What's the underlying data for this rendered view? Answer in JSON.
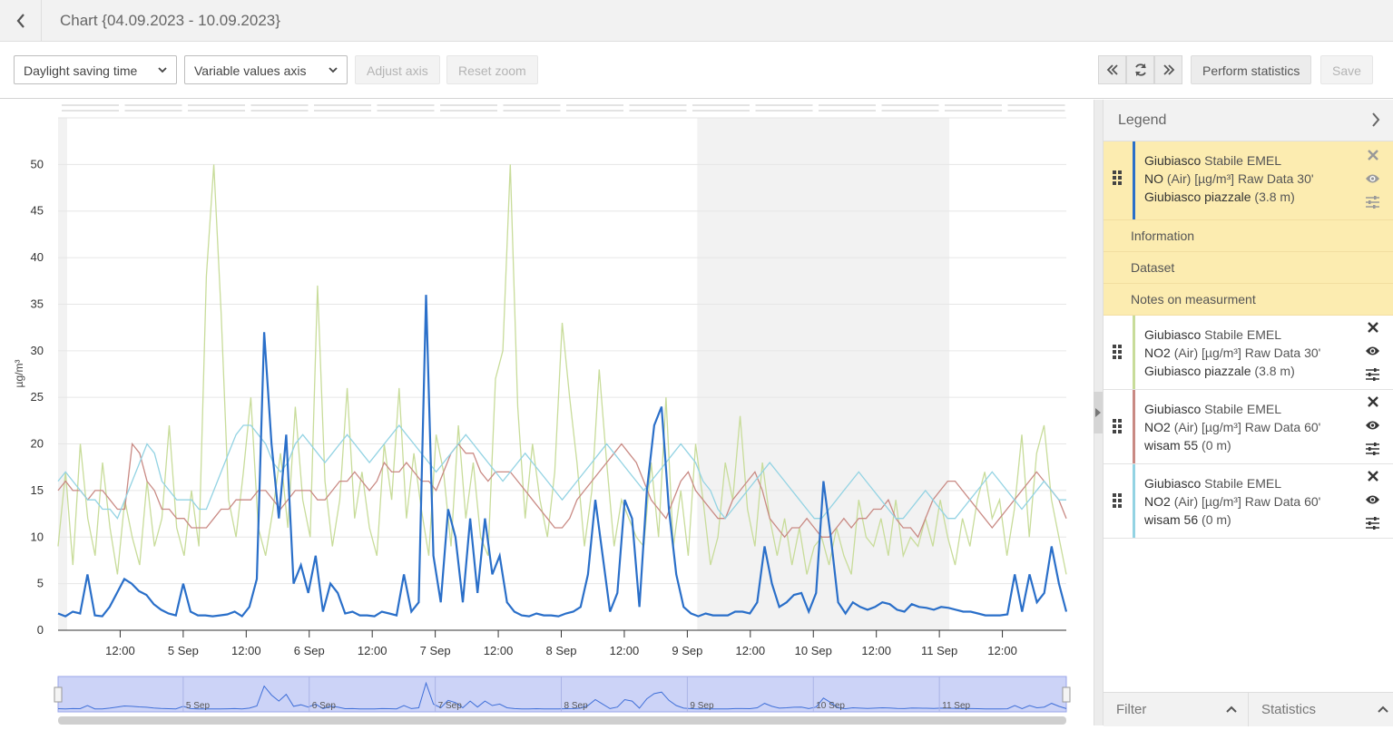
{
  "header": {
    "title": "Chart {04.09.2023 - 10.09.2023}"
  },
  "toolbar": {
    "timezone_select": "Daylight saving time",
    "axis_select": "Variable values axis",
    "adjust_axis": "Adjust axis",
    "reset_zoom": "Reset zoom",
    "perform_statistics": "Perform statistics",
    "save": "Save"
  },
  "chart_data": {
    "type": "line",
    "ylabel": "µg/m³",
    "ylim": [
      0,
      55
    ],
    "yticks": [
      "0",
      "5",
      "10",
      "15",
      "20",
      "25",
      "30",
      "35",
      "40",
      "45",
      "50"
    ],
    "xticks": [
      "12:00",
      "5 Sep",
      "12:00",
      "6 Sep",
      "12:00",
      "7 Sep",
      "12:00",
      "8 Sep",
      "12:00",
      "9 Sep",
      "12:00",
      "10 Sep",
      "12:00",
      "11 Sep",
      "12:00"
    ],
    "navigator_ticks": [
      "5 Sep",
      "6 Sep",
      "7 Sep",
      "8 Sep",
      "9 Sep",
      "10 Sep",
      "11 Sep"
    ],
    "x_range": [
      "4 Sep 00:00",
      "11 Sep 24:00"
    ],
    "highlight_range": [
      "9 Sep 00:00",
      "11 Sep 00:00"
    ],
    "series": [
      {
        "color": "#c8dc9a",
        "values": [
          9,
          17,
          7,
          20,
          12,
          8,
          18,
          11,
          6,
          14,
          10,
          7,
          16,
          9,
          12,
          22,
          11,
          8,
          15,
          9,
          38,
          50,
          34,
          14,
          10,
          17,
          25,
          11,
          8,
          13,
          19,
          11,
          24,
          14,
          10,
          37,
          16,
          9,
          14,
          26,
          12,
          17,
          11,
          8,
          20,
          14,
          26,
          12,
          19,
          13,
          8,
          21,
          17,
          9,
          22,
          12,
          18,
          10,
          8,
          27,
          30,
          50,
          24,
          12,
          20,
          14,
          10,
          17,
          33,
          25,
          18,
          9,
          15,
          28,
          18,
          9,
          14,
          12,
          10,
          9,
          18,
          10,
          25,
          9,
          15,
          8,
          20,
          14,
          7,
          10,
          18,
          14,
          23,
          13,
          9,
          18,
          12,
          8,
          12,
          7,
          11,
          6,
          9,
          10,
          7,
          11,
          8,
          6,
          14,
          10,
          9,
          12,
          8,
          14,
          8,
          10,
          9,
          12,
          9,
          14,
          10,
          7,
          12,
          9,
          14,
          17,
          12,
          14,
          8,
          13,
          21,
          10,
          19,
          22,
          14,
          10,
          6
        ]
      },
      {
        "color": "#c98a84",
        "values": [
          15,
          16,
          15,
          15,
          14,
          15,
          15,
          14,
          13,
          13,
          20,
          19,
          16,
          15,
          13,
          13,
          12,
          12,
          11,
          11,
          11,
          12,
          13,
          13,
          14,
          14,
          14,
          15,
          15,
          14,
          13,
          14,
          15,
          15,
          15,
          14,
          14,
          15,
          16,
          16,
          17,
          16,
          15,
          16,
          18,
          17,
          17,
          18,
          17,
          16,
          16,
          15,
          17,
          19,
          20,
          19,
          19,
          17,
          16,
          17,
          17,
          17,
          16,
          15,
          14,
          13,
          12,
          11,
          11,
          12,
          14,
          15,
          16,
          17,
          18,
          19,
          20,
          19,
          18,
          16,
          14,
          13,
          12,
          14,
          16,
          17,
          15,
          14,
          13,
          12,
          12,
          14,
          15,
          16,
          17,
          15,
          12,
          11,
          10,
          11,
          11,
          12,
          11,
          10,
          10,
          11,
          12,
          11,
          12,
          12,
          13,
          13,
          14,
          12,
          11,
          11,
          10,
          12,
          14,
          15,
          16,
          16,
          15,
          14,
          13,
          12,
          11,
          12,
          13,
          14,
          15,
          16,
          17,
          16,
          15,
          14,
          12
        ]
      },
      {
        "color": "#93d3e3",
        "values": [
          16,
          17,
          16,
          15,
          14,
          14,
          13,
          13,
          12,
          14,
          16,
          18,
          20,
          19,
          16,
          15,
          14,
          14,
          14,
          13,
          13,
          15,
          17,
          19,
          21,
          22,
          22,
          21,
          20,
          18,
          17,
          18,
          20,
          21,
          20,
          19,
          18,
          19,
          20,
          21,
          20,
          19,
          18,
          19,
          20,
          21,
          22,
          21,
          20,
          19,
          18,
          17,
          18,
          19,
          20,
          21,
          20,
          19,
          18,
          17,
          16,
          17,
          18,
          19,
          18,
          17,
          16,
          15,
          14,
          15,
          16,
          17,
          18,
          19,
          20,
          19,
          18,
          17,
          16,
          15,
          16,
          17,
          18,
          19,
          20,
          19,
          18,
          16,
          15,
          13,
          12,
          13,
          14,
          15,
          16,
          17,
          18,
          17,
          16,
          15,
          14,
          13,
          12,
          12,
          13,
          14,
          15,
          16,
          17,
          16,
          15,
          14,
          13,
          12,
          12,
          13,
          14,
          15,
          14,
          13,
          12,
          12,
          13,
          14,
          15,
          16,
          17,
          16,
          15,
          14,
          13,
          14,
          15,
          16,
          15,
          14,
          14
        ]
      },
      {
        "color": "#2a6fc9",
        "values": [
          1.8,
          1.5,
          2,
          1.8,
          6,
          1.6,
          1.5,
          2.5,
          4,
          5.5,
          5,
          4.2,
          3.8,
          2.8,
          2.2,
          1.8,
          1.6,
          5,
          2,
          1.6,
          1.6,
          1.5,
          1.6,
          1.7,
          2,
          1.5,
          2.5,
          5.5,
          32,
          20,
          12,
          21,
          5,
          7,
          4,
          8,
          2,
          5,
          4,
          1.8,
          2,
          1.6,
          1.6,
          1.5,
          2,
          1.8,
          1.6,
          6,
          2,
          3,
          36,
          8,
          3,
          13,
          10,
          3,
          12,
          4,
          12,
          6,
          8,
          3,
          2,
          1.6,
          1.5,
          1.8,
          1.6,
          1.6,
          1.5,
          1.8,
          2,
          2.5,
          6,
          14,
          8,
          2,
          4,
          14,
          12,
          2.5,
          15,
          22,
          24,
          13,
          6,
          2.5,
          1.8,
          1.5,
          1.8,
          1.6,
          1.6,
          1.6,
          2,
          2,
          1.8,
          3,
          9,
          5,
          2.5,
          3,
          3.8,
          4,
          2,
          4,
          16,
          10,
          3,
          1.8,
          3,
          2.5,
          2.2,
          2.5,
          3,
          2.8,
          2.2,
          2,
          2.8,
          2.5,
          2.4,
          2.2,
          2.5,
          2.4,
          2.2,
          2,
          2,
          1.8,
          1.6,
          1.6,
          1.6,
          1.7,
          6,
          2,
          6,
          3,
          4,
          9,
          5,
          2
        ]
      }
    ]
  },
  "legend": {
    "title": "Legend",
    "entries": [
      {
        "location": "Giubiasco",
        "provider": "Stabile EMEL",
        "phenomenon": "NO",
        "phen_detail": "(Air) [µg/m³] Raw Data 30'",
        "platform": "Giubiasco piazzale",
        "height": "(3.8 m)",
        "color": "#2a6fc9",
        "selected": true
      },
      {
        "location": "Giubiasco",
        "provider": "Stabile EMEL",
        "phenomenon": "NO2",
        "phen_detail": "(Air) [µg/m³] Raw Data 30'",
        "platform": "Giubiasco piazzale",
        "height": "(3.8 m)",
        "color": "#c8dc9a"
      },
      {
        "location": "Giubiasco",
        "provider": "Stabile EMEL",
        "phenomenon": "NO2",
        "phen_detail": "(Air) [µg/m³] Raw Data 60'",
        "platform": "wisam 55",
        "height": "(0 m)",
        "color": "#c98a84"
      },
      {
        "location": "Giubiasco",
        "provider": "Stabile EMEL",
        "phenomenon": "NO2",
        "phen_detail": "(Air) [µg/m³] Raw Data 60'",
        "platform": "wisam 56",
        "height": "(0 m)",
        "color": "#93d3e3"
      }
    ],
    "subrows": [
      "Information",
      "Dataset",
      "Notes on measurment"
    ]
  },
  "bottom_tabs": {
    "filter": "Filter",
    "statistics": "Statistics"
  }
}
